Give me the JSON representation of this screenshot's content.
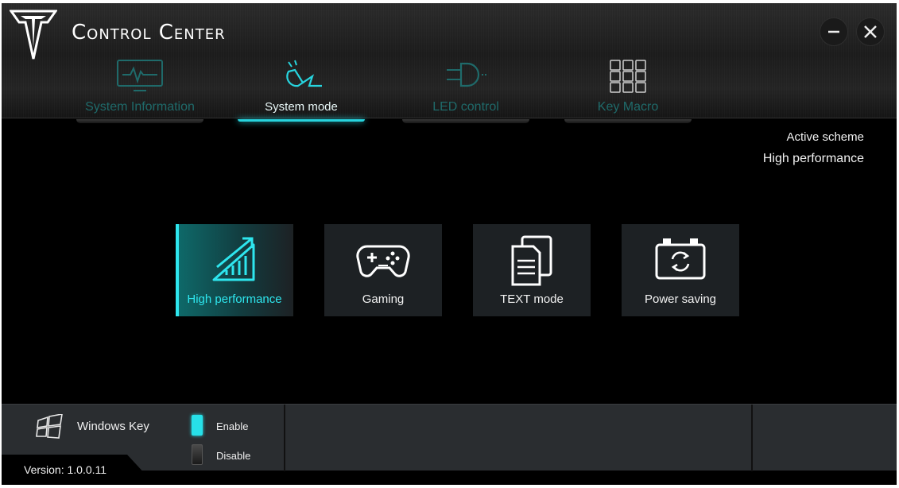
{
  "app": {
    "title": "Control Center"
  },
  "window_controls": {
    "minimize": "—",
    "close": "✕"
  },
  "tabs": [
    {
      "label": "System Information",
      "icon": "monitor-pulse-icon",
      "active": false
    },
    {
      "label": "System mode",
      "icon": "mode-plug-icon",
      "active": true
    },
    {
      "label": "LED control",
      "icon": "led-bulb-icon",
      "active": false
    },
    {
      "label": "Key Macro",
      "icon": "keypad-icon",
      "active": false
    }
  ],
  "scheme": {
    "caption": "Active scheme",
    "value": "High performance"
  },
  "modes": [
    {
      "label": "High performance",
      "icon": "performance-chart-icon",
      "active": true
    },
    {
      "label": "Gaming",
      "icon": "gamepad-icon",
      "active": false
    },
    {
      "label": "TEXT mode",
      "icon": "document-icon",
      "active": false
    },
    {
      "label": "Power saving",
      "icon": "battery-cycle-icon",
      "active": false
    }
  ],
  "windows_key": {
    "label": "Windows Key",
    "enable_label": "Enable",
    "disable_label": "Disable",
    "state": "Enable"
  },
  "version": "Version: 1.0.0.11",
  "colors": {
    "accent": "#27d4de",
    "background": "#000000",
    "card": "#1d2124",
    "footer": "#2a2d30"
  }
}
